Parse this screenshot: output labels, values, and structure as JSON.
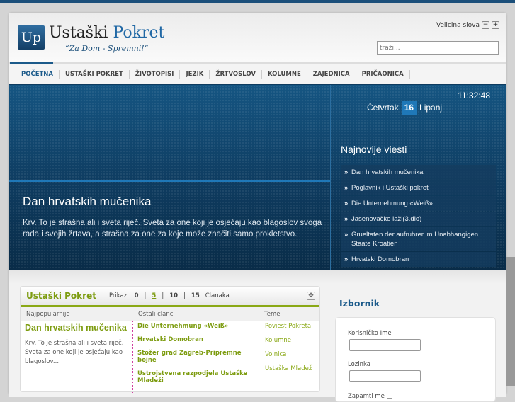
{
  "header": {
    "logo_mark": "Up",
    "logo_word1": "Ustaški",
    "logo_word2": "Pokret",
    "slogan": "“Za Dom - Spremni!”",
    "font_size_label": "Velicina slova",
    "font_minus": "−",
    "font_plus": "+",
    "search_placeholder": "traži..."
  },
  "nav": [
    "POČETNA",
    "USTAŠKI POKRET",
    "ŽIVOTOPISI",
    "JEZIK",
    "ŽRTVOSLOV",
    "KOLUMNE",
    "ZAJEDNICA",
    "PRIČAONICA"
  ],
  "banner": {
    "title": "Dan hrvatskih mučenika",
    "text": "Krv. To je strašna ali i sveta riječ. Sveta za one koji je osjećaju kao blagoslov svoga rada i svojih žrtava, a strašna za one za koje može značiti samo prokletstvo.",
    "time": "11:32:48",
    "weekday": "Četvrtak",
    "day": "16",
    "month": "Lipanj",
    "news_title": "Najnovije viesti",
    "news": [
      "Dan hrvatskih mučenika",
      "Poglavnik i Ustaški pokret",
      "Die Unternehmung «Weiß»",
      "Jasenovačke laži(3.dio)",
      "Grueltaten der aufruhrer im Unabhangigen Staate Kroatien",
      "Hrvatski Domobran"
    ]
  },
  "module": {
    "title": "Ustaški Pokret",
    "show_label": "Prikazi",
    "counts": [
      "0",
      "5",
      "10",
      "15"
    ],
    "sep": "|",
    "articles_label": "Clanaka",
    "col_popular": "Najpopularnije",
    "col_other": "Ostali clanci",
    "col_topics": "Teme",
    "popular_title": "Dan hrvatskih mučenika",
    "popular_text": "Krv. To je strašna ali i sveta riječ. Sveta za one koji je osjećaju kao blagoslov...",
    "other": [
      "Die Unternehmung «Weiß»",
      "Hrvatski Domobran",
      "Stožer grad Zagreb-Pripremne bojne",
      "Ustrojstvena razpodjela Ustaške Mladeži"
    ],
    "topics": [
      "Poviest Pokreta",
      "Kolumne",
      "Vojnica",
      "Ustaška Mladež"
    ]
  },
  "login": {
    "title": "Izbornik",
    "username_label": "Korisničko Ime",
    "password_label": "Lozinka",
    "remember_label": "Zapamti me"
  }
}
